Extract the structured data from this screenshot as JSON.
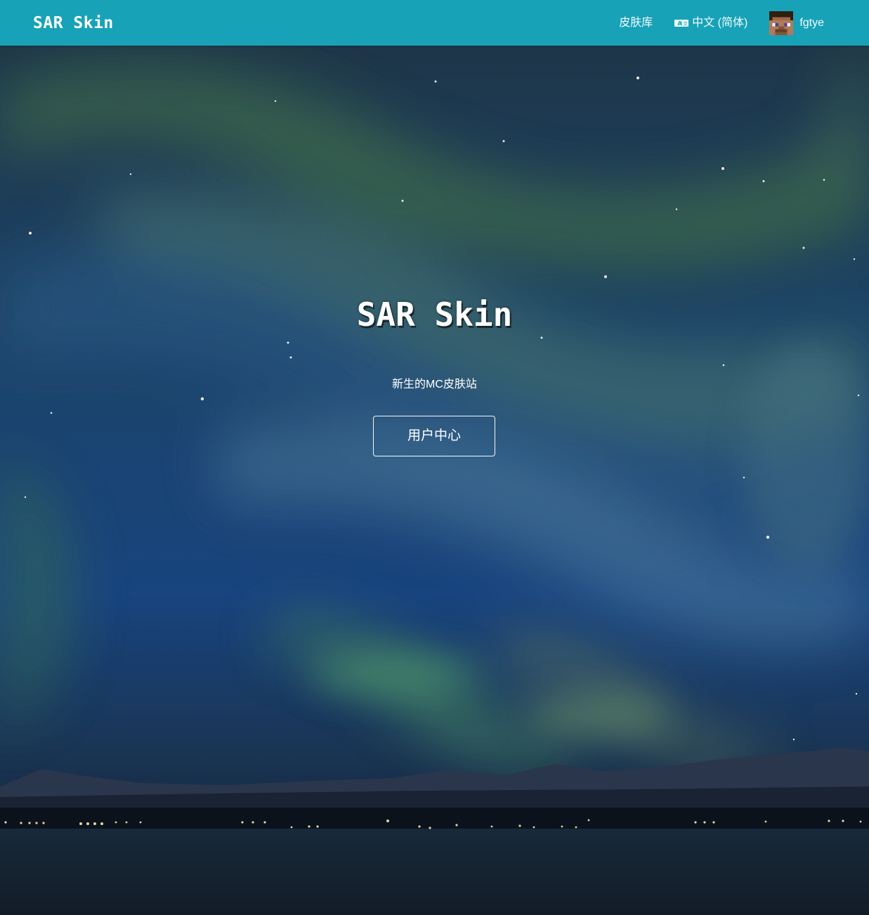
{
  "theme": {
    "navbar_bg": "#17a2b8",
    "text": "#ffffff"
  },
  "navbar": {
    "brand": "SAR Skin",
    "links": {
      "skin_library": "皮肤库",
      "language": "中文 (简体)",
      "username": "fgtye"
    },
    "icons": {
      "language": "translate-icon",
      "user": "steve-avatar"
    }
  },
  "hero": {
    "title": "SAR Skin",
    "subtitle": "新生的MC皮肤站",
    "button": "用户中心"
  }
}
